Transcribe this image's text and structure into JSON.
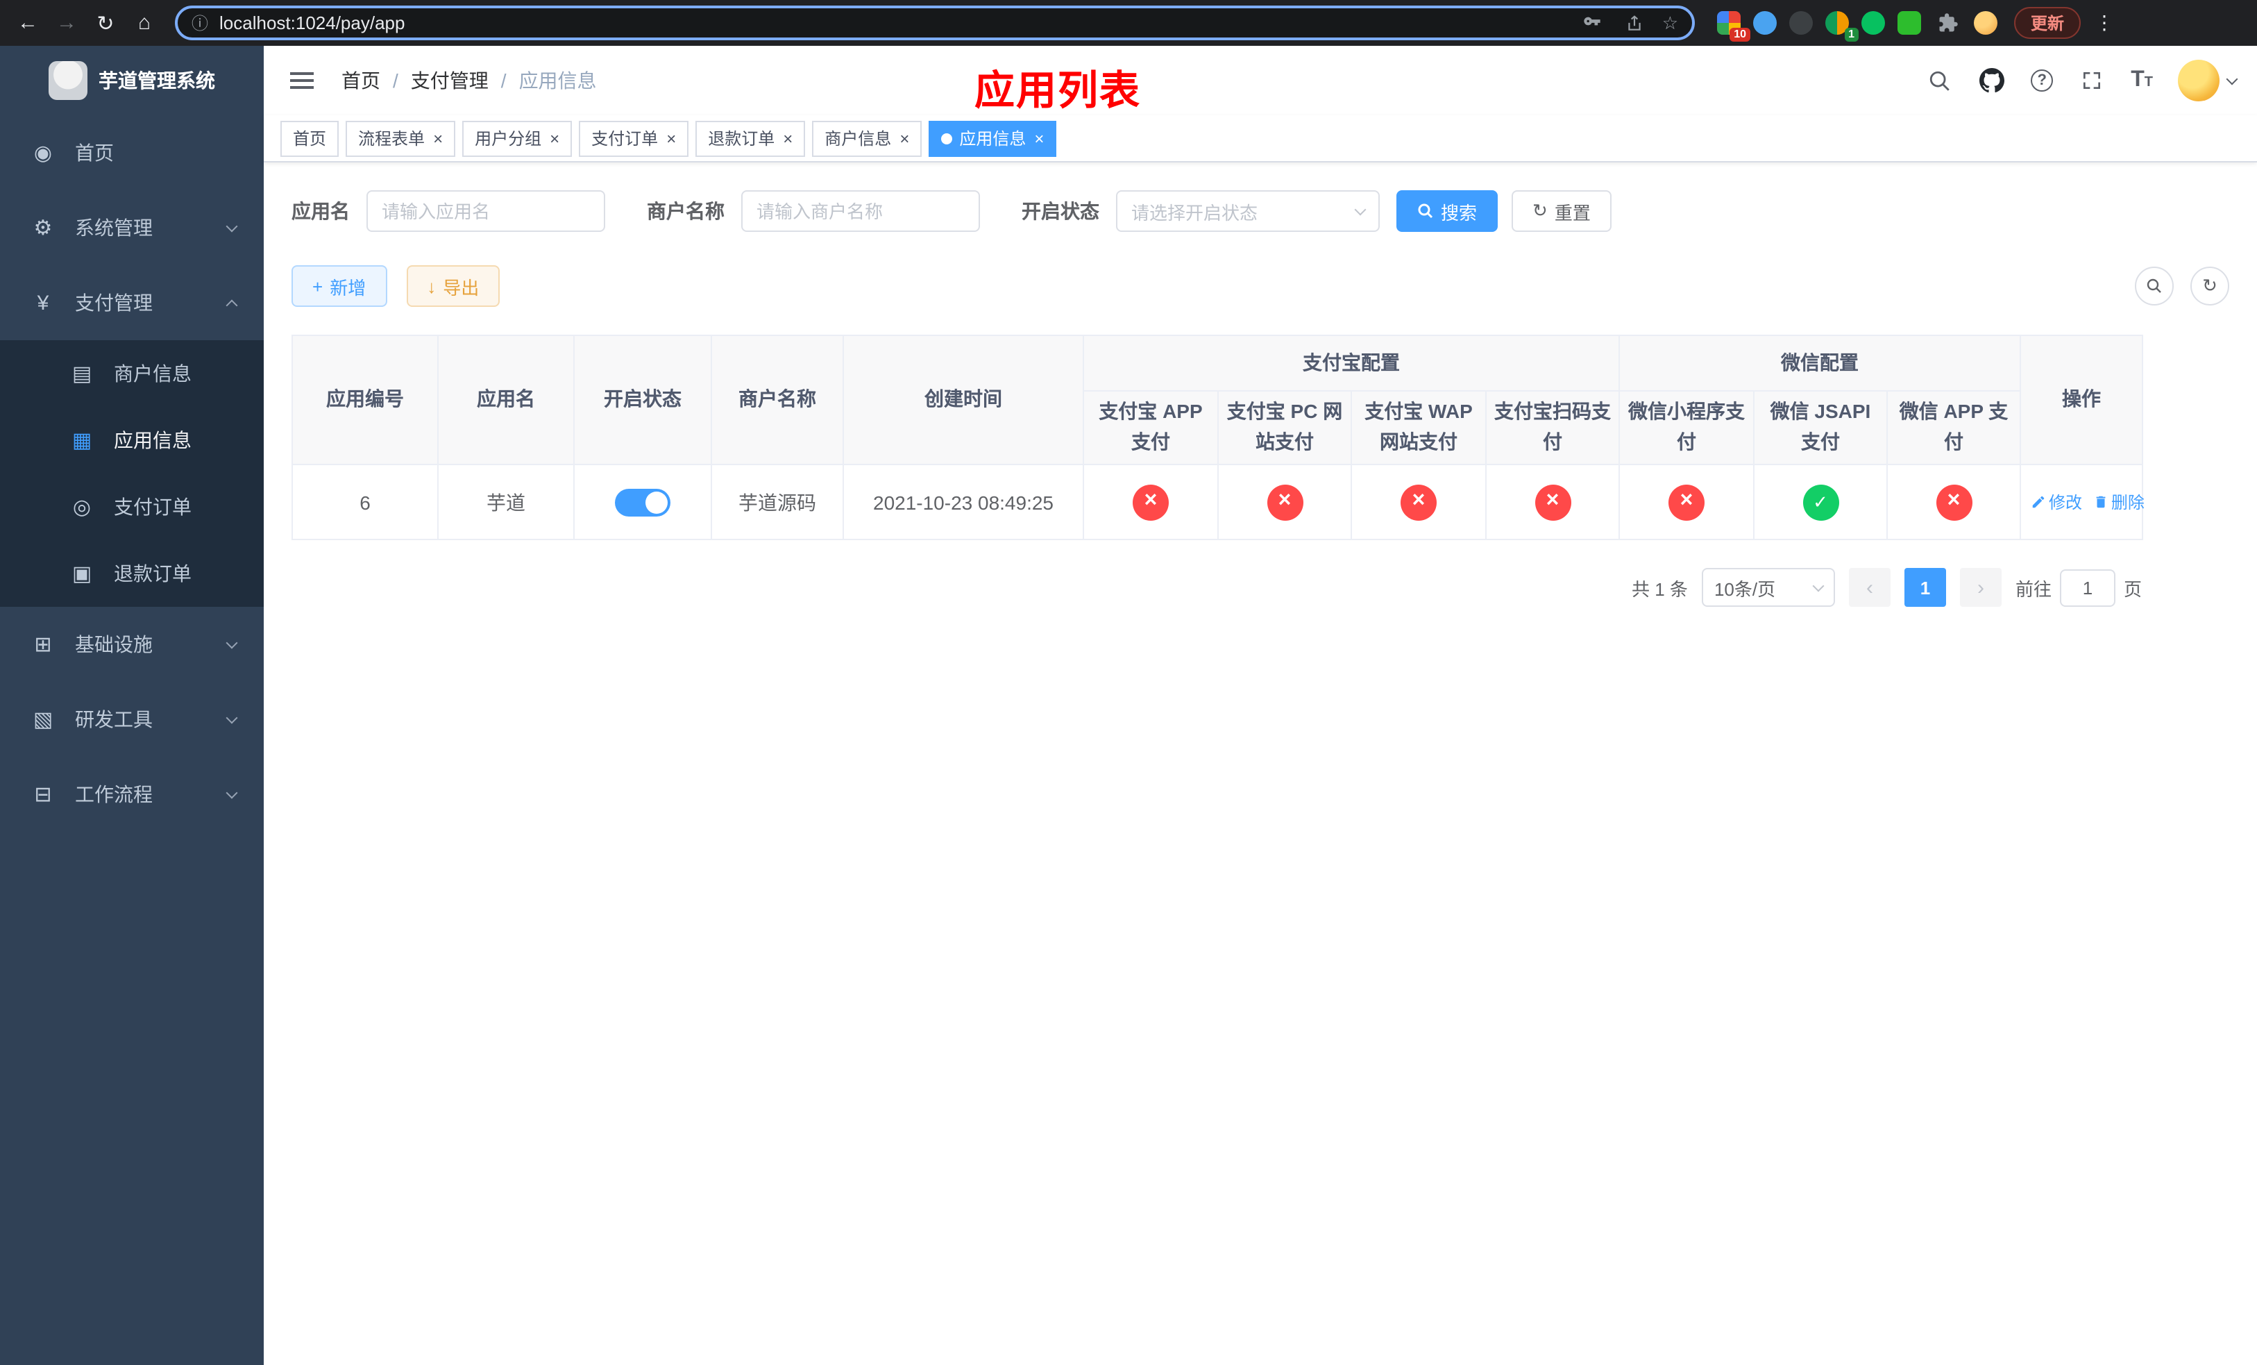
{
  "browser": {
    "url": "localhost:1024/pay/app",
    "update_label": "更新",
    "ext_badge_red": "10",
    "ext_badge_green": "1"
  },
  "glyphs": {
    "back": "←",
    "forward": "→",
    "reload": "↻",
    "home": "⌂",
    "info": "ⓘ",
    "star": "☆",
    "menu_dots": "⋮",
    "prev": "‹",
    "next": "›",
    "refresh": "↻",
    "plus": "+",
    "download": "↓"
  },
  "sidebar": {
    "app_title": "芋道管理系统",
    "menu": [
      {
        "label": "首页",
        "icon": "◉"
      },
      {
        "label": "系统管理",
        "icon": "⚙"
      },
      {
        "label": "支付管理",
        "icon": "¥"
      },
      {
        "label": "基础设施",
        "icon": "⊞"
      },
      {
        "label": "研发工具",
        "icon": "▧"
      },
      {
        "label": "工作流程",
        "icon": "⊟"
      }
    ],
    "pay_submenu": [
      {
        "label": "商户信息",
        "icon": "▤"
      },
      {
        "label": "应用信息",
        "icon": "▦"
      },
      {
        "label": "支付订单",
        "icon": "◎"
      },
      {
        "label": "退款订单",
        "icon": "▣"
      }
    ]
  },
  "navbar": {
    "breadcrumb": [
      {
        "label": "首页"
      },
      {
        "label": "支付管理"
      },
      {
        "label": "应用信息"
      }
    ],
    "page_title": "应用列表"
  },
  "tabs": [
    {
      "label": "首页"
    },
    {
      "label": "流程表单"
    },
    {
      "label": "用户分组"
    },
    {
      "label": "支付订单"
    },
    {
      "label": "退款订单"
    },
    {
      "label": "商户信息"
    },
    {
      "label": "应用信息"
    }
  ],
  "filters": {
    "app_name": {
      "label": "应用名",
      "placeholder": "请输入应用名"
    },
    "merchant_name": {
      "label": "商户名称",
      "placeholder": "请输入商户名称"
    },
    "status": {
      "label": "开启状态",
      "placeholder": "请选择开启状态"
    },
    "search_label": "搜索",
    "reset_label": "重置"
  },
  "toolbar": {
    "add_label": "新增",
    "export_label": "导出"
  },
  "table": {
    "header": {
      "app_id": "应用编号",
      "app_name": "应用名",
      "open_status": "开启状态",
      "merchant_name": "商户名称",
      "create_time": "创建时间",
      "alipay_group": "支付宝配置",
      "wechat_group": "微信配置",
      "actions": "操作",
      "cols": [
        "支付宝 APP 支付",
        "支付宝 PC 网站支付",
        "支付宝 WAP 网站支付",
        "支付宝扫码支付",
        "微信小程序支付",
        "微信 JSAPI 支付",
        "微信 APP 支付"
      ]
    },
    "rows": [
      {
        "app_id": "6",
        "app_name": "芋道",
        "open": "on",
        "merchant_name": "芋道源码",
        "create_time": "2021-10-23 08:49:25",
        "configs": [
          "no",
          "no",
          "no",
          "no",
          "no",
          "yes",
          "no"
        ],
        "edit_label": "修改",
        "delete_label": "删除"
      }
    ]
  },
  "pagination": {
    "total_text": "共 1 条",
    "page_size_text": "10条/页",
    "page": "1",
    "goto_prefix": "前往",
    "goto_value": "1",
    "goto_suffix": "页"
  },
  "colors": {
    "primary": "#409eff",
    "danger": "#ff4949",
    "success": "#13ce66",
    "page_title_red": "#ff0000",
    "sidebar_bg": "#304156",
    "submenu_bg": "#1f2d3d"
  }
}
